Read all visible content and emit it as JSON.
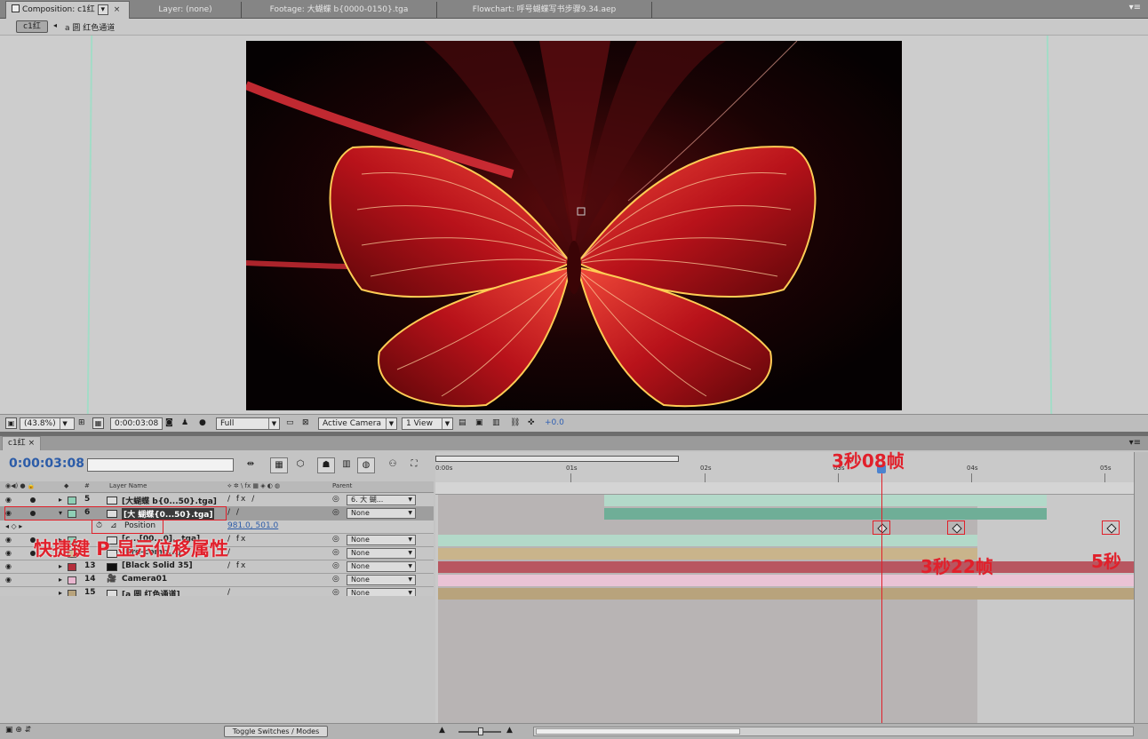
{
  "tabs": {
    "composition": "Composition: c1红",
    "layer": "Layer: (none)",
    "footage": "Footage: 大蝴蝶 b{0000-0150}.tga",
    "flowchart": "Flowchart: 呼号蝴蝶写书步骤9.34.aep"
  },
  "breadcrumb": {
    "comp": "c1红",
    "item": "a 圆 红色通道"
  },
  "viewer_toolbar": {
    "zoom": "(43.8%)",
    "timecode": "0:00:03:08",
    "resolution": "Full",
    "view": "Active Camera",
    "layout": "1 View",
    "exposure": "+0.0"
  },
  "timeline": {
    "tab": "c1红",
    "timecode": "0:00:03:08",
    "search_placeholder": "",
    "col_layer_name": "Layer Name",
    "col_parent": "Parent",
    "col_num": "#",
    "ruler_ticks": [
      "0:00s",
      "01s",
      "02s",
      "03s",
      "04s",
      "05s"
    ],
    "layers": [
      {
        "num": "5",
        "name": "[大蝴蝶 b{0...50}.tga]",
        "color": "#8fcfb5",
        "parent": "6. 大 蝴...",
        "switches": "/ fx /"
      },
      {
        "num": "6",
        "name": "[大 蝴蝶{0...50}.tga]",
        "color": "#8fcfb5",
        "parent": "None",
        "switches": "/ /"
      },
      {
        "num": "",
        "name": "[c...[00...0]...tga]",
        "color": "#8fcfb5",
        "parent": "None",
        "switches": "/ fx"
      },
      {
        "num": "",
        "name": "[Pre-comp...]",
        "color": "#c9b48b",
        "parent": "None",
        "switches": "/"
      },
      {
        "num": "13",
        "name": "[Black Solid 35]",
        "color": "#b52f3c",
        "parent": "None",
        "switches": "/ fx"
      },
      {
        "num": "14",
        "name": "Camera01",
        "color": "#e8b6cf",
        "parent": "None",
        "switches": ""
      },
      {
        "num": "15",
        "name": "[a 圆 红色通道]",
        "color": "#b8a37c",
        "parent": "None",
        "switches": "/"
      }
    ],
    "property": {
      "name": "Position",
      "value": "981.0, 501.0"
    },
    "toggle_label": "Toggle Switches / Modes"
  },
  "annotations": {
    "kf1": "3秒08帧",
    "kf2": "3秒22帧",
    "kf3": "5秒",
    "shortcut": "快捷键 P 显示位移属性"
  },
  "colors": {
    "accent": "#2c5ca8",
    "annotation": "#e1202b",
    "playhead": "#e0202a"
  }
}
